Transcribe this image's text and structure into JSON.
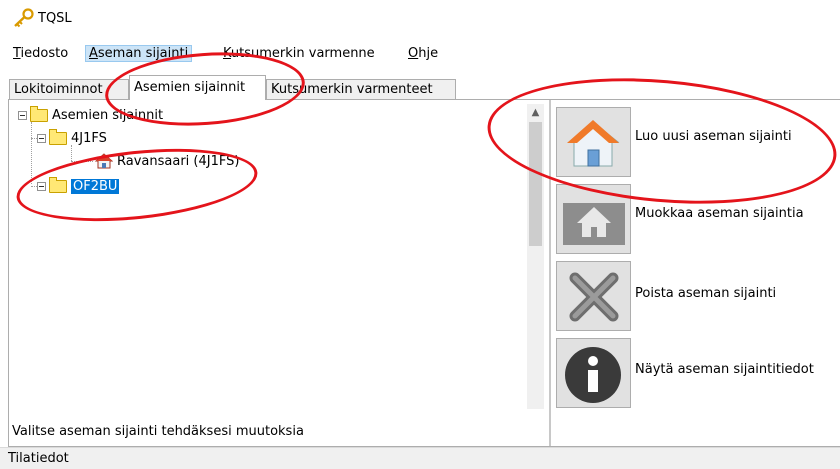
{
  "window": {
    "title": "TQSL",
    "app_icon": "key-icon"
  },
  "menu": [
    {
      "label": "Tiedosto",
      "mnemonic": "T"
    },
    {
      "label": "Aseman sijainti",
      "mnemonic": "A"
    },
    {
      "label": "Kutsumerkin varmenne",
      "mnemonic": "K"
    },
    {
      "label": "Ohje",
      "mnemonic": "O"
    }
  ],
  "tabs": [
    {
      "label": "Lokitoiminnot",
      "active": false
    },
    {
      "label": "Asemien sijainnit",
      "active": true
    },
    {
      "label": "Kutsumerkin varmenteet",
      "active": false
    }
  ],
  "tree": {
    "root": {
      "label": "Asemien sijainnit",
      "icon": "folder-icon"
    },
    "children": [
      {
        "label": "4J1FS",
        "icon": "folder-icon",
        "children": [
          {
            "label": "Ravansaari (4J1FS)",
            "icon": "house-icon"
          }
        ]
      },
      {
        "label": "OF2BU",
        "icon": "folder-icon",
        "selected": true
      }
    ]
  },
  "actions": [
    {
      "label": "Luo uusi aseman sijainti",
      "icon": "house-icon"
    },
    {
      "label": "Muokkaa aseman sijaintia",
      "icon": "house-edit-icon"
    },
    {
      "label": "Poista aseman sijainti",
      "icon": "x-icon"
    },
    {
      "label": "Näytä aseman sijaintitiedot",
      "icon": "info-icon"
    }
  ],
  "hint": "Valitse aseman sijainti tehdäksesi muutoksia",
  "status_label": "Tilatiedot",
  "colors": {
    "selection": "#0078d7",
    "annotation": "#e4141b",
    "folder": "#ffe875"
  }
}
